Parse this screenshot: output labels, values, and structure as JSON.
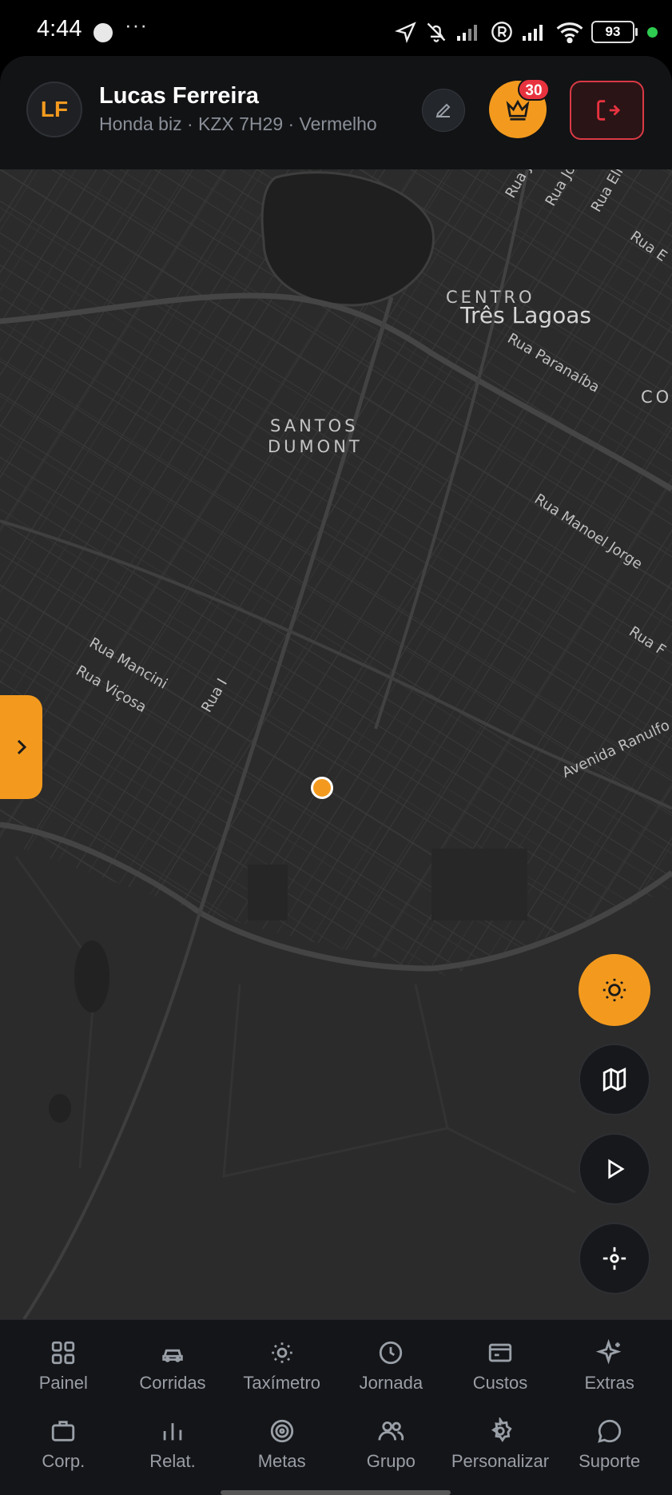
{
  "status_bar": {
    "time": "4:44",
    "more": "···",
    "battery": "93"
  },
  "header": {
    "avatar_initials": "LF",
    "driver_name": "Lucas Ferreira",
    "vehicle_info": "Honda biz · KZX 7H29 · Vermelho",
    "notification_count": "30"
  },
  "map": {
    "city_label": "Três Lagoas",
    "districts": {
      "centro": "CENTRO",
      "santos": "SANTOS",
      "dumont": "DUMONT",
      "co": "CO"
    },
    "streets": {
      "joao1": "Rua João",
      "joao2": "Rua João",
      "elmano": "Rua Elmano",
      "ruaE": "Rua E",
      "paranaiba": "Rua Paranaíba",
      "manoel_jorge": "Rua Manoel Jorge",
      "ruaF": "Rua F",
      "mancini": "Rua Mancini",
      "vicosa": "Rua Viçosa",
      "ruaI": "Rua I",
      "ranulfo": "Avenida Ranulfo"
    }
  },
  "nav": [
    {
      "label": "Painel",
      "icon": "grid-icon"
    },
    {
      "label": "Corridas",
      "icon": "car-icon"
    },
    {
      "label": "Taxímetro",
      "icon": "sun-icon"
    },
    {
      "label": "Jornada",
      "icon": "clock-icon"
    },
    {
      "label": "Custos",
      "icon": "wallet-icon"
    },
    {
      "label": "Extras",
      "icon": "sparkles-icon"
    },
    {
      "label": "Corp.",
      "icon": "briefcase-icon"
    },
    {
      "label": "Relat.",
      "icon": "bar-chart-icon"
    },
    {
      "label": "Metas",
      "icon": "target-icon"
    },
    {
      "label": "Grupo",
      "icon": "users-icon"
    },
    {
      "label": "Personalizar",
      "icon": "gear-icon"
    },
    {
      "label": "Suporte",
      "icon": "chat-bubble-icon"
    }
  ],
  "colors": {
    "accent": "#f39a1e",
    "danger": "#e8333f",
    "map_bg": "#2a2a2a",
    "panel": "#141518"
  }
}
